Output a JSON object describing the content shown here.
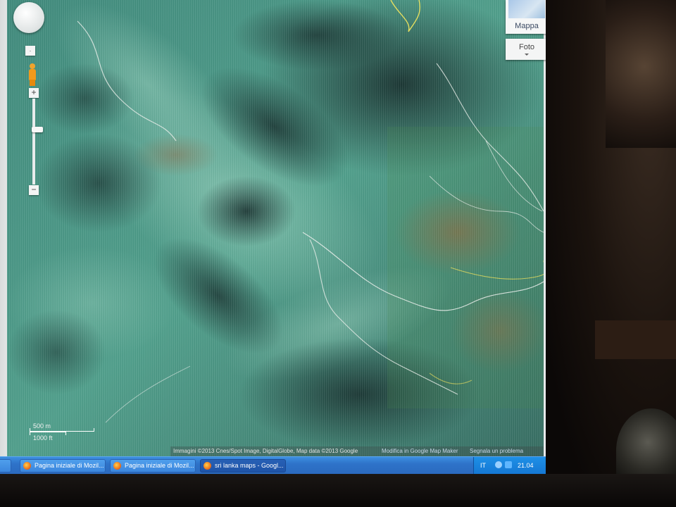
{
  "map": {
    "type_buttons": {
      "map_label": "Mappa",
      "photo_label": "Foto"
    },
    "zoom": {
      "plus": "+",
      "minus": "−"
    },
    "scale": {
      "metric": "500 m",
      "imperial": "1000 ft"
    },
    "attribution": {
      "imagery": "Immagini ©2013 Cnes/Spot Image, DigitalGlobe, Map data ©2013 Google",
      "map_maker": "Modifica in Google Map Maker",
      "report": "Segnala un problema"
    }
  },
  "taskbar": {
    "items": [
      {
        "label": ""
      },
      {
        "label": "Pagina iniziale di Mozil..."
      },
      {
        "label": "Pagina iniziale di Mozil..."
      },
      {
        "label": "sri lanka maps - Googl..."
      }
    ],
    "tray": {
      "language": "IT",
      "clock": "21.04"
    }
  },
  "colors": {
    "taskbar_blue": "#2e73c9",
    "map_forest": "#2f5f58",
    "map_clearing": "#6fb3a0",
    "road_white": "#f0f0f0",
    "boundary_yellow": "#e6e05a"
  }
}
